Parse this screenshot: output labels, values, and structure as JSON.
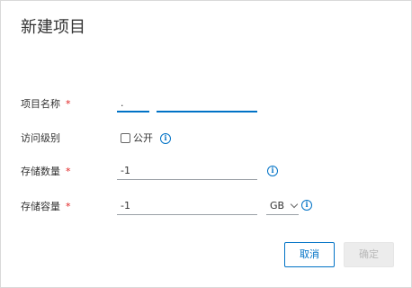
{
  "dialog": {
    "title": "新建项目",
    "fields": {
      "name": {
        "label": "项目名称",
        "required_mark": "*",
        "value_part1": ".",
        "value_part2": ""
      },
      "access": {
        "label": "访问级别",
        "checkbox_label": "公开",
        "checked": false,
        "info_icon": "info-icon"
      },
      "quantity": {
        "label": "存储数量",
        "required_mark": "*",
        "value": "-1",
        "info_icon": "info-icon"
      },
      "capacity": {
        "label": "存储容量",
        "required_mark": "*",
        "value": "-1",
        "unit": "GB",
        "info_icon": "info-icon"
      }
    },
    "buttons": {
      "cancel": "取消",
      "ok": "确定"
    }
  },
  "colors": {
    "accent": "#0072c6",
    "required": "#e02020",
    "disabled_bg": "#ececec",
    "disabled_text": "#b8b8b8"
  }
}
